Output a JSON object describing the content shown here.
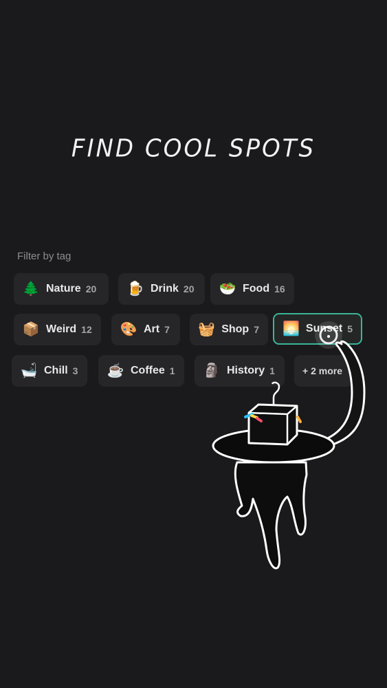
{
  "title": "FIND COOL SPOTS",
  "filter": {
    "label": "Filter by tag",
    "tags": [
      {
        "label": "Nature",
        "count": "20",
        "icon": "tree-icon",
        "emoji": "🌲",
        "selected": false
      },
      {
        "label": "Drink",
        "count": "20",
        "icon": "beer-icon",
        "emoji": "🍺",
        "selected": false
      },
      {
        "label": "Food",
        "count": "16",
        "icon": "food-bowl-icon",
        "emoji": "🥗",
        "selected": false
      },
      {
        "label": "Weird",
        "count": "12",
        "icon": "box-icon",
        "emoji": "📦",
        "selected": false
      },
      {
        "label": "Art",
        "count": "7",
        "icon": "palette-icon",
        "emoji": "🎨",
        "selected": false
      },
      {
        "label": "Shop",
        "count": "7",
        "icon": "basket-icon",
        "emoji": "🧺",
        "selected": false
      },
      {
        "label": "Sunset",
        "count": "5",
        "icon": "sunset-icon",
        "emoji": "🌅",
        "selected": true
      },
      {
        "label": "Chill",
        "count": "3",
        "icon": "bathtub-icon",
        "emoji": "🛁",
        "selected": false
      },
      {
        "label": "Coffee",
        "count": "1",
        "icon": "coffee-icon",
        "emoji": "☕",
        "selected": false
      },
      {
        "label": "History",
        "count": "1",
        "icon": "moai-icon",
        "emoji": "🗿",
        "selected": false
      }
    ],
    "more_label": "+ 2 more"
  },
  "colors": {
    "background": "#1a191b",
    "chip": "#262528",
    "selected_border": "#3bb59a"
  }
}
